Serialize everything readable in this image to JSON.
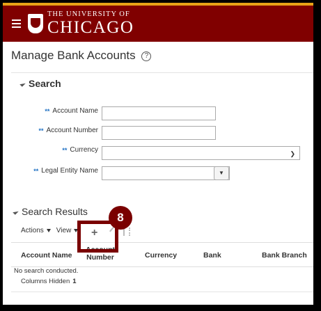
{
  "header": {
    "logo_top": "THE UNIVERSITY OF",
    "logo_main": "CHICAGO"
  },
  "page": {
    "title": "Manage Bank Accounts",
    "help_glyph": "?"
  },
  "search": {
    "heading": "Search",
    "fields": [
      {
        "label": "Account Name",
        "value": "",
        "required_marker": "**"
      },
      {
        "label": "Account Number",
        "value": "",
        "required_marker": "**"
      },
      {
        "label": "Currency",
        "value": "",
        "required_marker": "**"
      },
      {
        "label": "Legal Entity Name",
        "value": "",
        "required_marker": "**"
      }
    ]
  },
  "results": {
    "heading": "Search Results",
    "toolbar": {
      "actions_label": "Actions",
      "view_label": "View",
      "add_glyph": "+"
    },
    "columns": [
      "Account Name",
      "Account Number",
      "Currency",
      "Bank",
      "Bank Branch"
    ],
    "empty_message": "No search conducted.",
    "columns_hidden_label": "Columns Hidden",
    "columns_hidden_count": "1"
  },
  "annotation": {
    "step_number": "8",
    "color": "#7a0000"
  },
  "colors": {
    "brand": "#800000",
    "accent_bar": "#e8a317",
    "required_marker": "#1d6fc2"
  }
}
